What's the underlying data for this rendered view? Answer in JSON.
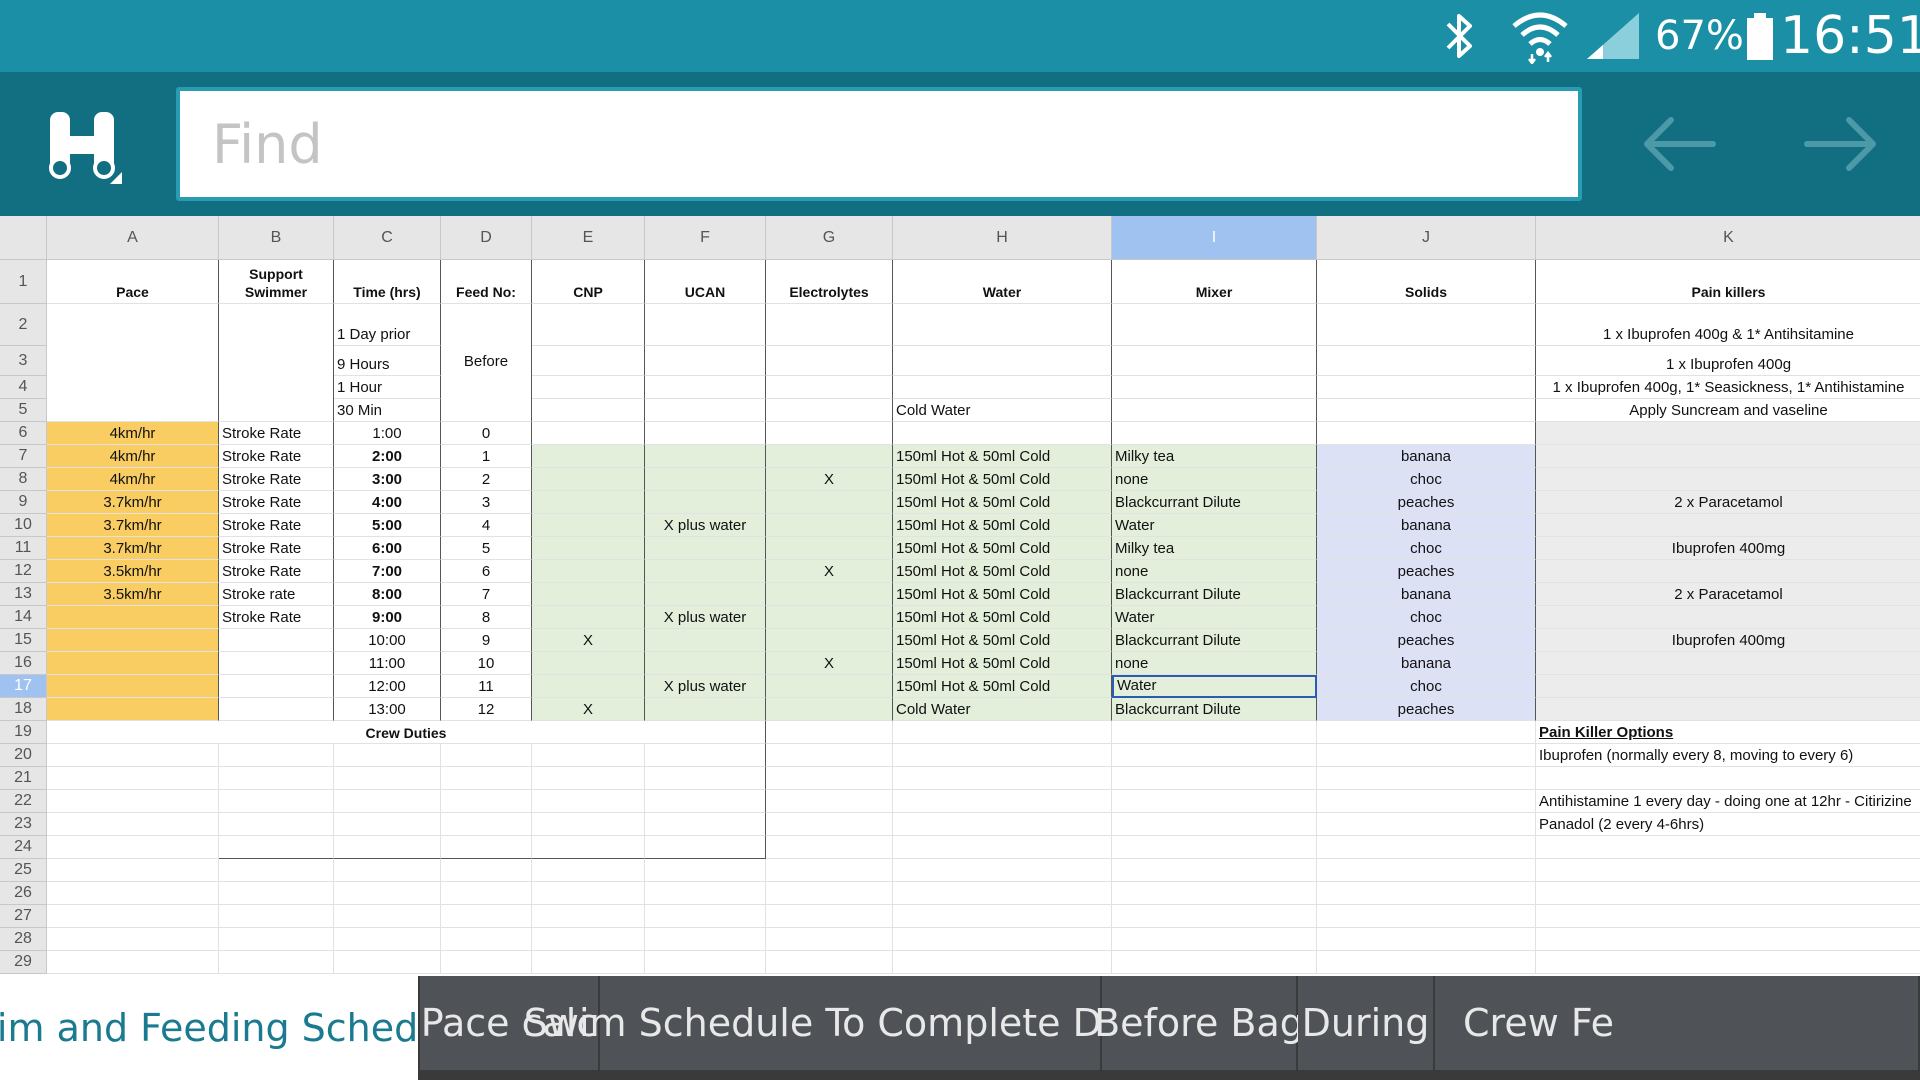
{
  "status": {
    "battery_percent": "67%",
    "clock": "16:51"
  },
  "find": {
    "placeholder": "Find"
  },
  "colors": {
    "status_bar": "#1b8fa5",
    "find_bar": "#126f81",
    "pace_fill": "#f9cd62",
    "green_fill": "#e3eedb",
    "blue_fill": "#dde1f5",
    "pink_fill": "#ececec",
    "selected_header": "#9fc2f0"
  },
  "columns": [
    "A",
    "B",
    "C",
    "D",
    "E",
    "F",
    "G",
    "H",
    "I",
    "J",
    "K"
  ],
  "selected_column": "I",
  "selected_row": "17",
  "row_numbers": [
    "1",
    "2",
    "3",
    "4",
    "5",
    "6",
    "7",
    "8",
    "9",
    "10",
    "11",
    "12",
    "13",
    "14",
    "15",
    "16",
    "17",
    "18",
    "19",
    "20",
    "21",
    "22",
    "23",
    "24",
    "25",
    "26",
    "27",
    "28",
    "29"
  ],
  "headers": {
    "A": "Pace",
    "B": "Support Swimmer",
    "C": "Time (hrs)",
    "D": "Feed No:",
    "E": "CNP",
    "F": "UCAN",
    "G": "Electrolytes",
    "H": "Water",
    "I": "Mixer",
    "J": "Solids",
    "K": "Pain killers"
  },
  "before": {
    "times": [
      "1 Day prior",
      "9 Hours",
      "1 Hour",
      "30 Min"
    ],
    "feed_label": "Before",
    "water_30min": "Cold Water",
    "pain_killers": [
      "1 x Ibuprofen 400g & 1* Antihsitamine",
      "1 x Ibuprofen 400g",
      "1 x Ibuprofen 400g, 1* Seasickness, 1* Antihistamine",
      "Apply Suncream and vaseline"
    ]
  },
  "schedule": [
    {
      "pace": "4km/hr",
      "swimmer": "Stroke Rate",
      "time": "1:00",
      "feed": "0",
      "cnp": "",
      "ucan": "",
      "elec": "",
      "water": "",
      "mixer": "",
      "solids": "",
      "pain": ""
    },
    {
      "pace": "4km/hr",
      "swimmer": "Stroke Rate",
      "time": "2:00",
      "feed": "1",
      "cnp": "",
      "ucan": "",
      "elec": "",
      "water": "150ml Hot & 50ml Cold",
      "mixer": "Milky tea",
      "solids": "banana",
      "pain": ""
    },
    {
      "pace": "4km/hr",
      "swimmer": "Stroke Rate",
      "time": "3:00",
      "feed": "2",
      "cnp": "",
      "ucan": "",
      "elec": "X",
      "water": "150ml Hot & 50ml Cold",
      "mixer": "none",
      "solids": "choc",
      "pain": ""
    },
    {
      "pace": "3.7km/hr",
      "swimmer": "Stroke Rate",
      "time": "4:00",
      "feed": "3",
      "cnp": "",
      "ucan": "",
      "elec": "",
      "water": "150ml Hot & 50ml Cold",
      "mixer": "Blackcurrant Dilute",
      "solids": "peaches",
      "pain": "2 x Paracetamol"
    },
    {
      "pace": "3.7km/hr",
      "swimmer": "Stroke Rate",
      "time": "5:00",
      "feed": "4",
      "cnp": "",
      "ucan": "X plus water",
      "elec": "",
      "water": "150ml Hot & 50ml Cold",
      "mixer": "Water",
      "solids": "banana",
      "pain": ""
    },
    {
      "pace": "3.7km/hr",
      "swimmer": "Stroke Rate",
      "time": "6:00",
      "feed": "5",
      "cnp": "",
      "ucan": "",
      "elec": "",
      "water": "150ml Hot & 50ml Cold",
      "mixer": "Milky tea",
      "solids": "choc",
      "pain": "Ibuprofen 400mg"
    },
    {
      "pace": "3.5km/hr",
      "swimmer": "Stroke Rate",
      "time": "7:00",
      "feed": "6",
      "cnp": "",
      "ucan": "",
      "elec": "X",
      "water": "150ml Hot & 50ml Cold",
      "mixer": "none",
      "solids": "peaches",
      "pain": ""
    },
    {
      "pace": "3.5km/hr",
      "swimmer": "Stroke  rate",
      "time": "8:00",
      "feed": "7",
      "cnp": "",
      "ucan": "",
      "elec": "",
      "water": "150ml Hot & 50ml Cold",
      "mixer": "Blackcurrant Dilute",
      "solids": "banana",
      "pain": "2 x Paracetamol"
    },
    {
      "pace": "",
      "swimmer": "Stroke Rate",
      "time": "9:00",
      "feed": "8",
      "cnp": "",
      "ucan": "X plus water",
      "elec": "",
      "water": "150ml Hot & 50ml Cold",
      "mixer": "Water",
      "solids": "choc",
      "pain": ""
    },
    {
      "pace": "",
      "swimmer": "",
      "time": "10:00",
      "feed": "9",
      "cnp": "X",
      "ucan": "",
      "elec": "",
      "water": "150ml Hot & 50ml Cold",
      "mixer": "Blackcurrant Dilute",
      "solids": "peaches",
      "pain": "Ibuprofen 400mg"
    },
    {
      "pace": "",
      "swimmer": "",
      "time": "11:00",
      "feed": "10",
      "cnp": "",
      "ucan": "",
      "elec": "X",
      "water": "150ml Hot & 50ml Cold",
      "mixer": "none",
      "solids": "banana",
      "pain": ""
    },
    {
      "pace": "",
      "swimmer": "",
      "time": "12:00",
      "feed": "11",
      "cnp": "",
      "ucan": "X plus water",
      "elec": "",
      "water": "150ml Hot & 50ml Cold",
      "mixer": "Water",
      "solids": "choc",
      "pain": ""
    },
    {
      "pace": "",
      "swimmer": "",
      "time": "13:00",
      "feed": "12",
      "cnp": "X",
      "ucan": "",
      "elec": "",
      "water": "Cold Water",
      "mixer": "Blackcurrant Dilute",
      "solids": "peaches",
      "pain": ""
    }
  ],
  "crew_duties": "Crew Duties",
  "pain_options": {
    "title": "Pain Killer Options",
    "lines": [
      "Ibuprofen (normally every 8, moving to every 6)",
      "",
      "Antihistamine 1 every day - doing one at 12hr - Citirizine",
      "Panadol (2 every 4-6hrs)"
    ]
  },
  "tabs": [
    {
      "label": "Swim and Feeding Schedule",
      "active": true
    },
    {
      "label": "Pace calc",
      "active": false
    },
    {
      "label": "Swim Schedule To Complete Durin",
      "active": false
    },
    {
      "label": "Before Bag",
      "active": false
    },
    {
      "label": "During",
      "active": false
    },
    {
      "label": "Crew Fe",
      "active": false
    }
  ]
}
